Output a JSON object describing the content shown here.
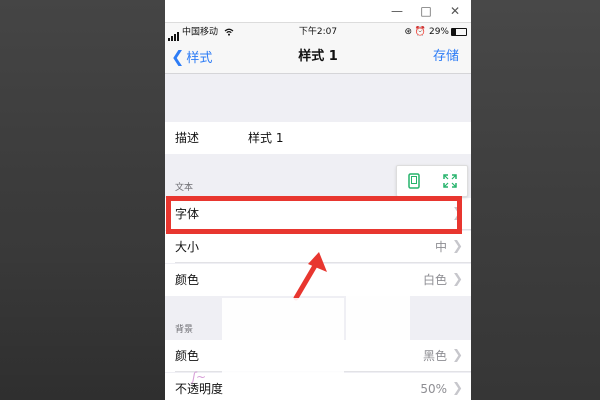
{
  "status_bar": {
    "carrier": "中国移动",
    "time": "下午2:07",
    "battery": "29%"
  },
  "nav": {
    "back_label": "样式",
    "title": "样式 1",
    "save_label": "存储"
  },
  "description": {
    "label": "描述",
    "value": "样式 1"
  },
  "text_section": {
    "header": "文本",
    "rows": [
      {
        "label": "字体",
        "value": ""
      },
      {
        "label": "大小",
        "value": "中"
      },
      {
        "label": "颜色",
        "value": "白色"
      }
    ]
  },
  "background_section": {
    "header": "背景",
    "rows": [
      {
        "label": "颜色",
        "value": "黑色"
      },
      {
        "label": "不透明度",
        "value": "50%"
      }
    ]
  },
  "colors": {
    "accent": "#2d7cf6",
    "annotation_red": "#e8362f",
    "float_icon": "#25b36b"
  }
}
